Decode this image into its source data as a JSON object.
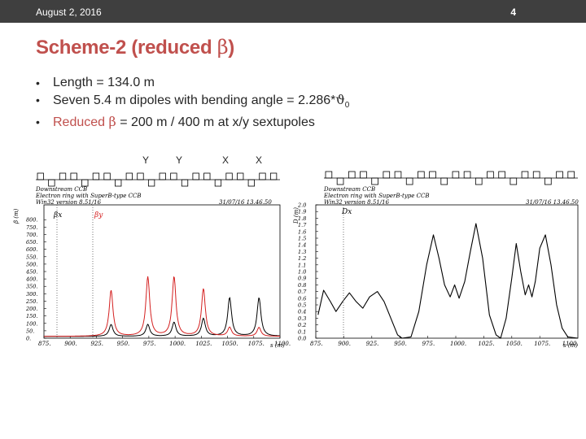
{
  "header": {
    "date": "August 2, 2016",
    "page_number": "4"
  },
  "title": {
    "text": "Scheme-2 (reduced ",
    "symbol": "β",
    "close": ")"
  },
  "bullets": {
    "b1": "Length = 134.0 m",
    "b2_pre": "Seven 5.4 m dipoles with bending angle = 2.286*",
    "b2_sym": "ϑ",
    "b2_sub": "0",
    "b3_pre": "Reduced ",
    "b3_sym": "β",
    "b3_post": " = 200 m / 400 m at x/y sextupoles"
  },
  "sextupole_labels": [
    "Y",
    "Y",
    "X",
    "X"
  ],
  "left_plot": {
    "caption1": "Downstream CCB",
    "caption2": "Electron ring with SuperB-type CCB",
    "caption3": "Win32 version 8.51/16",
    "date": "31/07/16  13.46.50",
    "ylabel": "β (m)",
    "xlabel": "s (m)",
    "marker_x": "βx",
    "marker_y": "βy",
    "colors": {
      "beta_x": "#000000",
      "beta_y": "#d42020"
    }
  },
  "right_plot": {
    "caption1": "Downstream CCB",
    "caption2": "Electron ring with SuperB-type CCB",
    "caption3": "Win32 version 8.51/16",
    "date": "31/07/16  13.46.50",
    "ylabel": "D (m)",
    "xlabel": "s (m)",
    "marker": "Dx",
    "colors": {
      "dispersion": "#000000"
    }
  },
  "chart_data": [
    {
      "type": "line",
      "title": "",
      "xlabel": "s (m)",
      "ylabel": "β (m)",
      "xlim": [
        875,
        1100
      ],
      "ylim": [
        0,
        900
      ],
      "x_ticks": [
        875,
        900,
        925,
        950,
        975,
        1000,
        1025,
        1050,
        1075,
        1100
      ],
      "y_ticks": [
        0,
        50,
        100,
        150,
        200,
        250,
        300,
        350,
        400,
        450,
        500,
        550,
        600,
        650,
        700,
        750,
        800
      ],
      "series": [
        {
          "name": "βx",
          "peaks": [
            [
              939,
              80
            ],
            [
              974,
              80
            ],
            [
              999,
              95
            ],
            [
              1027,
              120
            ],
            [
              1052,
              260
            ],
            [
              1080,
              260
            ]
          ]
        },
        {
          "name": "βy",
          "peaks": [
            [
              939,
              310
            ],
            [
              974,
              400
            ],
            [
              999,
              400
            ],
            [
              1027,
              320
            ],
            [
              1052,
              60
            ],
            [
              1080,
              60
            ]
          ]
        }
      ]
    },
    {
      "type": "line",
      "title": "",
      "xlabel": "s (m)",
      "ylabel": "D (m)",
      "xlim": [
        875,
        1109
      ],
      "ylim": [
        0,
        2.0
      ],
      "x_ticks": [
        875,
        900,
        925,
        950,
        975,
        1000,
        1025,
        1050,
        1075,
        1100
      ],
      "y_ticks": [
        0.0,
        0.1,
        0.2,
        0.3,
        0.4,
        0.5,
        0.6,
        0.7,
        0.8,
        0.9,
        1.0,
        1.1,
        1.2,
        1.3,
        1.4,
        1.5,
        1.6,
        1.7,
        1.8,
        1.9,
        2.0
      ],
      "series": [
        {
          "name": "Dx",
          "points": [
            [
              877,
              0.35
            ],
            [
              882,
              0.72
            ],
            [
              888,
              0.55
            ],
            [
              893,
              0.4
            ],
            [
              899,
              0.55
            ],
            [
              905,
              0.68
            ],
            [
              911,
              0.55
            ],
            [
              917,
              0.45
            ],
            [
              923,
              0.62
            ],
            [
              930,
              0.7
            ],
            [
              936,
              0.55
            ],
            [
              942,
              0.3
            ],
            [
              948,
              0.05
            ],
            [
              952,
              0.0
            ],
            [
              960,
              0.02
            ],
            [
              967,
              0.4
            ],
            [
              974,
              1.1
            ],
            [
              980,
              1.55
            ],
            [
              985,
              1.2
            ],
            [
              990,
              0.8
            ],
            [
              995,
              0.62
            ],
            [
              999,
              0.8
            ],
            [
              1003,
              0.6
            ],
            [
              1008,
              0.85
            ],
            [
              1013,
              1.3
            ],
            [
              1018,
              1.72
            ],
            [
              1024,
              1.2
            ],
            [
              1030,
              0.35
            ],
            [
              1036,
              0.05
            ],
            [
              1040,
              0.0
            ],
            [
              1045,
              0.3
            ],
            [
              1050,
              0.9
            ],
            [
              1054,
              1.42
            ],
            [
              1058,
              1.0
            ],
            [
              1062,
              0.65
            ],
            [
              1065,
              0.8
            ],
            [
              1068,
              0.62
            ],
            [
              1071,
              0.85
            ],
            [
              1075,
              1.35
            ],
            [
              1080,
              1.55
            ],
            [
              1085,
              1.1
            ],
            [
              1090,
              0.5
            ],
            [
              1095,
              0.15
            ],
            [
              1100,
              0.02
            ],
            [
              1109,
              0.0
            ]
          ]
        }
      ]
    }
  ]
}
